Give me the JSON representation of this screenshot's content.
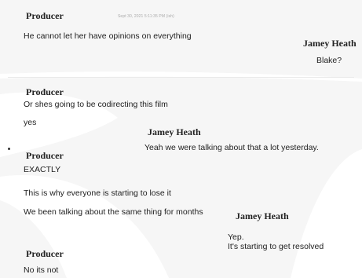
{
  "header": {
    "name": "Producer",
    "timestamp": "Sept 30, 2021 5:11:35 PM (ish)"
  },
  "messages": [
    {
      "text": "He cannot let her have opinions on everything"
    },
    {
      "speaker": "Jamey Heath",
      "text": "Blake?"
    },
    {
      "speaker": "Producer",
      "lines": [
        "Or shes going to be codirecting this film",
        "yes"
      ]
    },
    {
      "speaker": "Jamey Heath",
      "text": "Yeah we were talking about that a lot yesterday."
    },
    {
      "speaker": "Producer",
      "lines": [
        "EXACTLY",
        "This is why everyone is starting to lose it",
        "We been talking about the same thing for months"
      ]
    },
    {
      "speaker": "Jamey Heath",
      "lines": [
        "Yep.",
        "It's starting to get resolved"
      ]
    },
    {
      "speaker": "Producer",
      "text": "No its not"
    }
  ],
  "colors": {
    "background": "#f6f6f6",
    "shape": "#ffffff",
    "text": "#1a1a1a",
    "name": "#222222"
  }
}
